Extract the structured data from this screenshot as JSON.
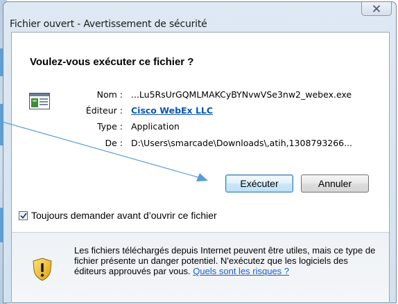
{
  "window": {
    "title": "Fichier ouvert - Avertissement de sécurité"
  },
  "dialog": {
    "question": "Voulez-vous exécuter ce fichier ?",
    "fields": [
      {
        "label": "Nom :",
        "value": "...Lu5RsUrGQMLMAKCyBYNvwVSe3nw2_webex.exe",
        "is_link": false
      },
      {
        "label": "Éditeur :",
        "value": "Cisco WebEx LLC",
        "is_link": true
      },
      {
        "label": "Type :",
        "value": "Application",
        "is_link": false
      },
      {
        "label": "De :",
        "value": "D:\\Users\\smarcade\\Downloads\\,atih,1308793266...",
        "is_link": false
      }
    ],
    "buttons": {
      "run": "Exécuter",
      "cancel": "Annuler"
    },
    "checkbox": {
      "label": "Toujours demander avant d’ouvrir ce fichier",
      "checked": true
    },
    "warning": {
      "text": "Les fichiers téléchargés depuis Internet peuvent être utiles, mais ce type de fichier présente un danger potentiel. N'exécutez que les logiciels des éditeurs approuvés par vous. ",
      "link": "Quels sont les risques ?"
    }
  },
  "icons": {
    "close": "close-icon",
    "file": "application-file-icon",
    "shield": "warning-shield-icon",
    "checkmark": "checkmark-icon",
    "annotation": "annotation-arrow"
  },
  "colors": {
    "link": "#0b57b5",
    "accent_arrow": "#5b9bd5",
    "shield_yellow": "#f4c21f"
  }
}
